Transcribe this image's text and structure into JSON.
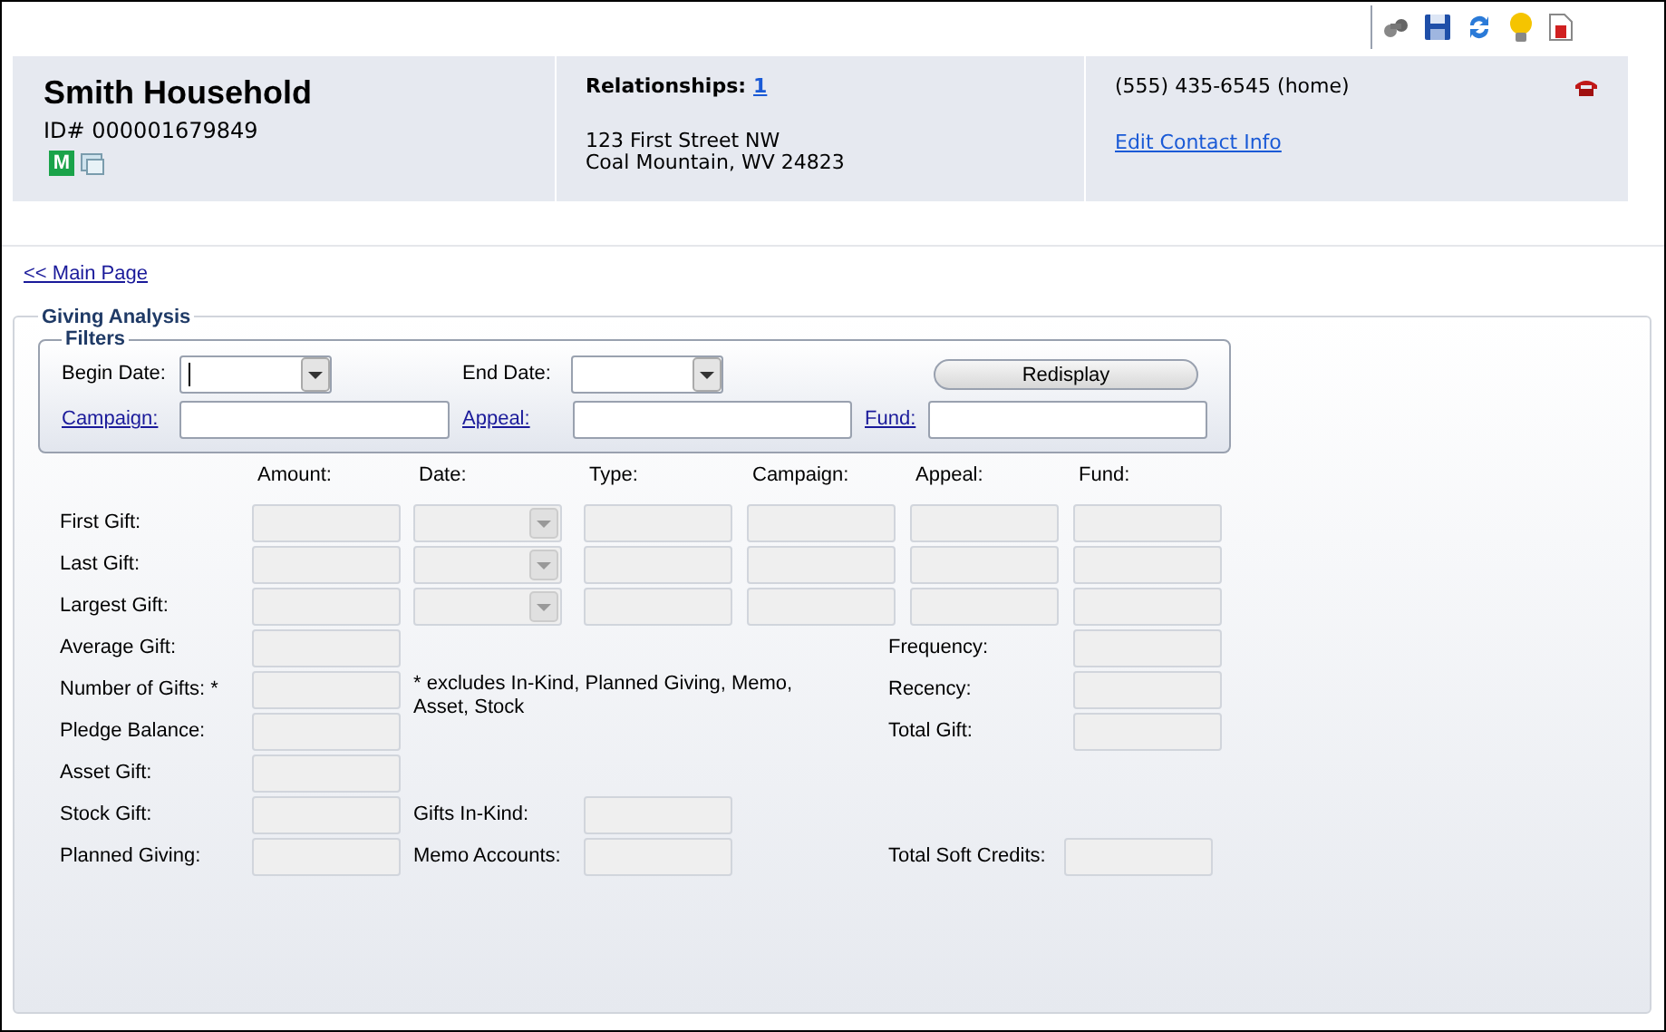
{
  "household": {
    "name": "Smith Household",
    "id": "ID# 000001679849",
    "badge": "M"
  },
  "relationships": {
    "label": "Relationships:",
    "count": "1",
    "address_lines": [
      "123 First Street NW",
      "Coal Mountain, WV 24823"
    ]
  },
  "contact": {
    "phone": "(555) 435-6545 (home)",
    "edit_link": "Edit Contact Info"
  },
  "main_page_link": "<< Main Page",
  "giving_analysis": {
    "title": "Giving Analysis",
    "filters": {
      "title": "Filters",
      "begin_date": {
        "label": "Begin Date:",
        "focused": true
      },
      "end_date": {
        "label": "End Date:",
        "focused": false
      },
      "button": "Redisplay",
      "lookups": [
        {
          "label": "Campaign:"
        },
        {
          "label": "Appeal:"
        },
        {
          "label": "Fund:"
        }
      ]
    },
    "columns": [
      "Amount:",
      "Date:",
      "Type:",
      "Campaign:",
      "Appeal:",
      "Fund:"
    ],
    "gift_rows": [
      {
        "label": "First Gift:",
        "date_disabled": true
      },
      {
        "label": "Last Gift:",
        "date_disabled": true
      },
      {
        "label": "Largest Gift:",
        "date_disabled": true
      }
    ],
    "summary_rows": [
      {
        "label": "Average Gift:",
        "right_label": "Frequency:"
      },
      {
        "label": "Number of Gifts: *",
        "note": "* excludes In-Kind, Planned Giving, Memo, Asset, Stock",
        "right_label": "Recency:"
      },
      {
        "label": "Pledge Balance:",
        "right_label": "Total Gift:"
      },
      {
        "label": "Asset Gift:"
      },
      {
        "label": "Stock Gift:",
        "middle_label": "Gifts In-Kind:"
      },
      {
        "label": "Planned Giving:",
        "middle_label": "Memo Accounts:",
        "right_label": "Total Soft Credits:"
      }
    ]
  }
}
